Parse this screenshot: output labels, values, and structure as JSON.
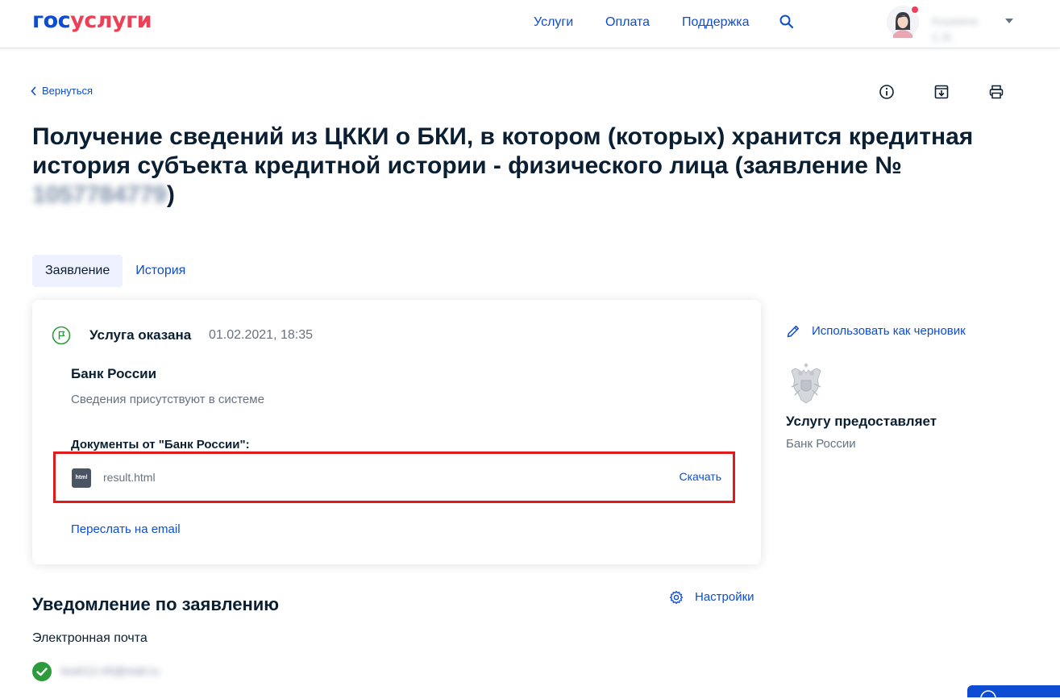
{
  "header": {
    "logo_part1": "гос",
    "logo_part2": "услуги",
    "nav": {
      "services": "Услуги",
      "payment": "Оплата",
      "support": "Поддержка"
    },
    "user_name": "Кошкина С.В."
  },
  "toolbar": {
    "back_label": "Вернуться"
  },
  "page": {
    "title_main": "Получение сведений из ЦККИ о БКИ, в котором (которых) хранится кредитная история субъекта кредитной истории - физического лица (заявление №",
    "application_number": "1057784779",
    "title_close": ")"
  },
  "tabs": {
    "application": "Заявление",
    "history": "История"
  },
  "status_card": {
    "status": "Услуга оказана",
    "date": "01.02.2021, 18:35",
    "org": "Банк России",
    "org_status": "Сведения присутствуют в системе",
    "docs_heading": "Документы от \"Банк России\":",
    "file_type": "html",
    "file_name": "result.html",
    "download": "Скачать",
    "forward_email": "Переслать на email"
  },
  "sidebar": {
    "use_as_draft": "Использовать как черновик",
    "provider_heading": "Услугу предоставляет",
    "provider_name": "Банк России"
  },
  "notifications": {
    "title": "Уведомление по заявлению",
    "settings": "Настройки",
    "email_label": "Электронная почта",
    "email_value": "kosh12-45@mail.ru"
  },
  "colors": {
    "accent": "#0d4cd3",
    "logo_red": "#ee3f58",
    "success": "#2d9b3b",
    "highlight_border": "#e01a1a"
  }
}
